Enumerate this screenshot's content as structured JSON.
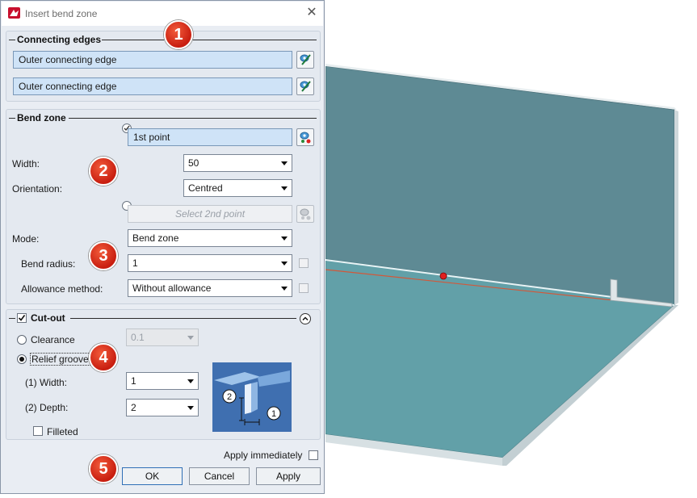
{
  "window": {
    "title": "Insert bend zone",
    "close_glyph": "✕"
  },
  "connecting_edges": {
    "title": "Connecting edges",
    "edge1": "Outer connecting edge",
    "edge2": "Outer connecting edge"
  },
  "bend_zone": {
    "title": "Bend zone",
    "point1": "1st point",
    "width_label": "Width:",
    "width_value": "50",
    "orientation_label": "Orientation:",
    "orientation_value": "Centred",
    "point2": "Select 2nd point",
    "mode_label": "Mode:",
    "mode_value": "Bend zone",
    "bend_radius_label": "Bend radius:",
    "bend_radius_value": "1",
    "allowance_label": "Allowance method:",
    "allowance_value": "Without allowance"
  },
  "cutout": {
    "title": "Cut-out",
    "checked": true,
    "clearance_label": "Clearance",
    "clearance_value": "0.1",
    "relief_label": "Relief groove",
    "selected": "relief",
    "width_label": "(1) Width:",
    "width_value": "1",
    "depth_label": "(2) Depth:",
    "depth_value": "2",
    "filleted_label": "Filleted",
    "diagram_label_1": "1",
    "diagram_label_2": "2"
  },
  "footer": {
    "apply_immediately": "Apply immediately",
    "ok": "OK",
    "cancel": "Cancel",
    "apply": "Apply"
  },
  "badges": [
    "1",
    "2",
    "3",
    "4",
    "5"
  ],
  "colors": {
    "plate_top": "#5f9ea6",
    "plate_wall": "#5e8a94",
    "plate_edge": "#e6ecee",
    "bend_line": "#d2583a",
    "point_marker": "#e02020",
    "badge": "#d92a17",
    "field_highlight": "#cfe3f7"
  }
}
